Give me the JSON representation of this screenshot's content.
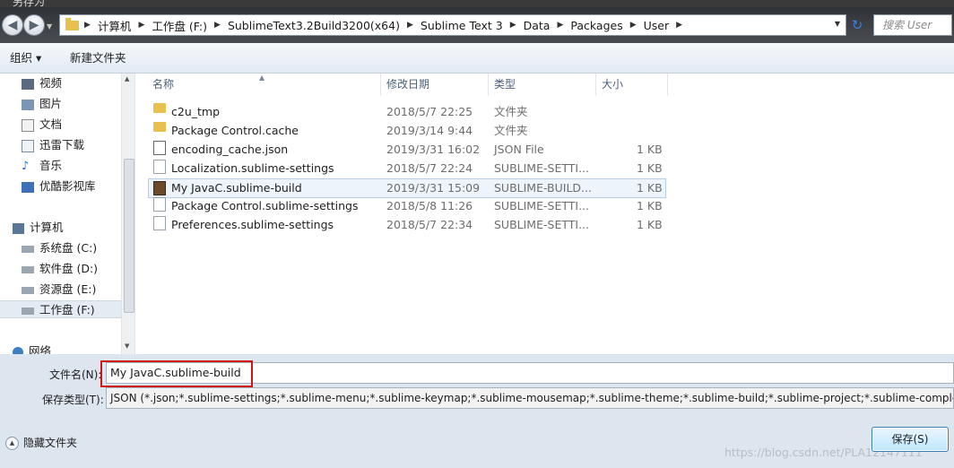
{
  "window": {
    "title": "另存为"
  },
  "address": {
    "crumbs": [
      "计算机",
      "工作盘 (F:)",
      "SublimeText3.2Build3200(x64)",
      "Sublime Text 3",
      "Data",
      "Packages",
      "User"
    ],
    "search_placeholder": "搜索 User"
  },
  "toolbar": {
    "organize": "组织 ▾",
    "new_folder": "新建文件夹"
  },
  "nav": {
    "items": [
      "视频",
      "图片",
      "文档",
      "迅雷下载",
      "音乐",
      "优酷影视库",
      "计算机",
      "系统盘 (C:)",
      "软件盘 (D:)",
      "资源盘 (E:)",
      "工作盘 (F:)",
      "网络"
    ]
  },
  "columns": {
    "name": "名称",
    "date": "修改日期",
    "type": "类型",
    "size": "大小"
  },
  "files": [
    {
      "name": "c2u_tmp",
      "date": "2018/5/7 22:25",
      "type": "文件夹",
      "size": ""
    },
    {
      "name": "Package Control.cache",
      "date": "2019/3/14 9:44",
      "type": "文件夹",
      "size": ""
    },
    {
      "name": "encoding_cache.json",
      "date": "2019/3/31 16:02",
      "type": "JSON File",
      "size": "1 KB"
    },
    {
      "name": "Localization.sublime-settings",
      "date": "2018/5/7 22:24",
      "type": "SUBLIME-SETTI...",
      "size": "1 KB"
    },
    {
      "name": "My JavaC.sublime-build",
      "date": "2019/3/31 15:09",
      "type": "SUBLIME-BUILD...",
      "size": "1 KB"
    },
    {
      "name": "Package Control.sublime-settings",
      "date": "2018/5/8 11:26",
      "type": "SUBLIME-SETTI...",
      "size": "1 KB"
    },
    {
      "name": "Preferences.sublime-settings",
      "date": "2018/5/7 22:34",
      "type": "SUBLIME-SETTI...",
      "size": "1 KB"
    }
  ],
  "form": {
    "filename_label": "文件名(N):",
    "filename_value": "My JavaC.sublime-build",
    "filetype_label": "保存类型(T):",
    "filetype_value": "JSON (*.json;*.sublime-settings;*.sublime-menu;*.sublime-keymap;*.sublime-mousemap;*.sublime-theme;*.sublime-build;*.sublime-project;*.sublime-completions;*.s"
  },
  "footer": {
    "hide_folders": "隐藏文件夹",
    "save": "保存(S)",
    "watermark": "https://blog.csdn.net/PLA12147111"
  },
  "colors": {
    "highlight_box": "#d01515",
    "selected_row": "#eef4fb"
  }
}
